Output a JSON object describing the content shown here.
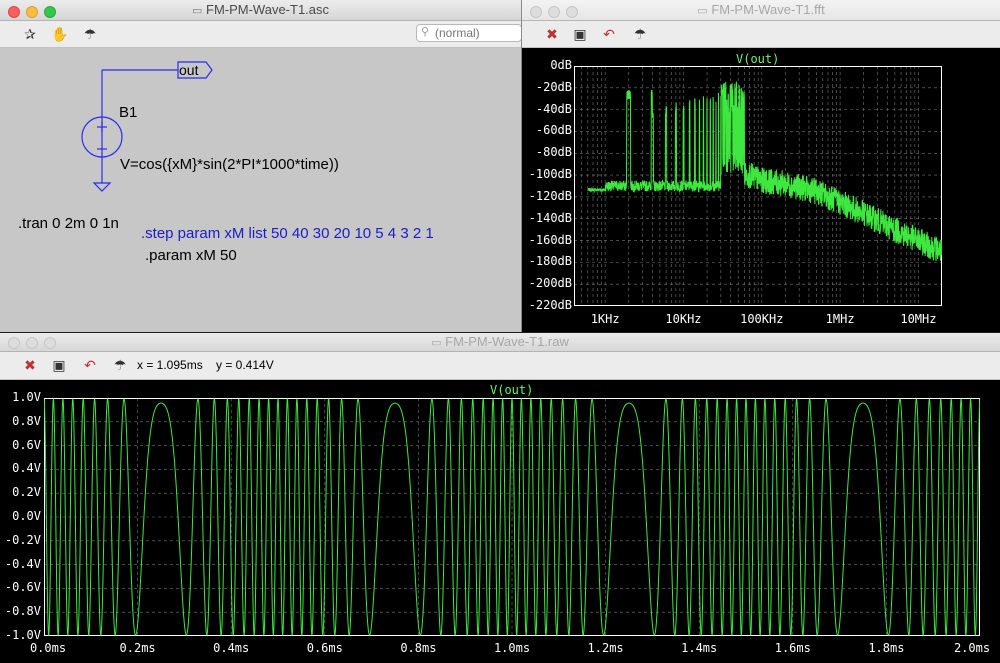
{
  "schematic": {
    "title": "FM-PM-Wave-T1.asc",
    "search_placeholder": "(normal)",
    "net_label": "out",
    "source_name": "B1",
    "source_value": "V=cos({xM}*sin(2*PI*1000*time))",
    "tran_directive": ".tran 0 2m 0 1n",
    "step_directive": ".step param xM list 50 40 30 20 10 5 4 3 2 1",
    "param_directive": ".param xM 50"
  },
  "fft": {
    "title": "FM-PM-Wave-T1.fft",
    "trace_name": "V(out)",
    "y_ticks": [
      "0dB",
      "-20dB",
      "-40dB",
      "-60dB",
      "-80dB",
      "-100dB",
      "-120dB",
      "-140dB",
      "-160dB",
      "-180dB",
      "-200dB",
      "-220dB"
    ],
    "x_ticks": [
      "1KHz",
      "10KHz",
      "100KHz",
      "1MHz",
      "10MHz"
    ]
  },
  "transient": {
    "title": "FM-PM-Wave-T1.raw",
    "cursor_x": "x = 1.095ms",
    "cursor_y": "y = 0.414V",
    "trace_name": "V(out)",
    "y_ticks": [
      "1.0V",
      "0.8V",
      "0.6V",
      "0.4V",
      "0.2V",
      "0.0V",
      "-0.2V",
      "-0.4V",
      "-0.6V",
      "-0.8V",
      "-1.0V"
    ],
    "x_ticks": [
      "0.0ms",
      "0.2ms",
      "0.4ms",
      "0.6ms",
      "0.8ms",
      "1.0ms",
      "1.2ms",
      "1.4ms",
      "1.6ms",
      "1.8ms",
      "2.0ms"
    ]
  },
  "colors": {
    "trace": "#3ee83e",
    "wire": "#2a2af0",
    "plot_bg": "#000000"
  },
  "icons": [
    "run-icon",
    "pan-hand-icon",
    "probe-icon",
    "autoscale-icon",
    "zoom-rect-icon",
    "undo-zoom-icon"
  ],
  "chart_data": [
    {
      "type": "line",
      "title": "V(out)",
      "xlabel": "",
      "ylabel": "",
      "x_scale": "log",
      "xlim": [
        400,
        20000000
      ],
      "ylim": [
        -220,
        0
      ],
      "grid": true,
      "series": [
        {
          "name": "V(out)",
          "x": [
            600,
            1000,
            1200,
            1600,
            2000,
            3000,
            4000,
            6000,
            8000,
            10000,
            12000,
            16000,
            20000,
            25000,
            30000,
            40000,
            50000,
            60000,
            70000,
            100000,
            200000,
            500000,
            1000000,
            2000000,
            5000000,
            10000000,
            20000000
          ],
          "y": [
            -115,
            -117,
            -122,
            -118,
            -100,
            -22,
            -108,
            -30,
            -26,
            -28,
            -22,
            -20,
            -16,
            -15,
            -15,
            -15,
            -14,
            -100,
            -100,
            -105,
            -108,
            -115,
            -125,
            -135,
            -150,
            -160,
            -170
          ]
        }
      ]
    },
    {
      "type": "line",
      "title": "V(out)",
      "xlabel": "",
      "ylabel": "",
      "formula": "V=cos(50*sin(2*PI*1000*time))",
      "xlim": [
        0,
        2
      ],
      "ylim": [
        -1,
        1
      ],
      "grid": true,
      "series": [
        {
          "name": "V(out)",
          "x_unit": "ms",
          "y_unit": "V",
          "x_range": [
            0,
            2
          ],
          "y_range": [
            -1,
            1
          ]
        }
      ]
    }
  ]
}
